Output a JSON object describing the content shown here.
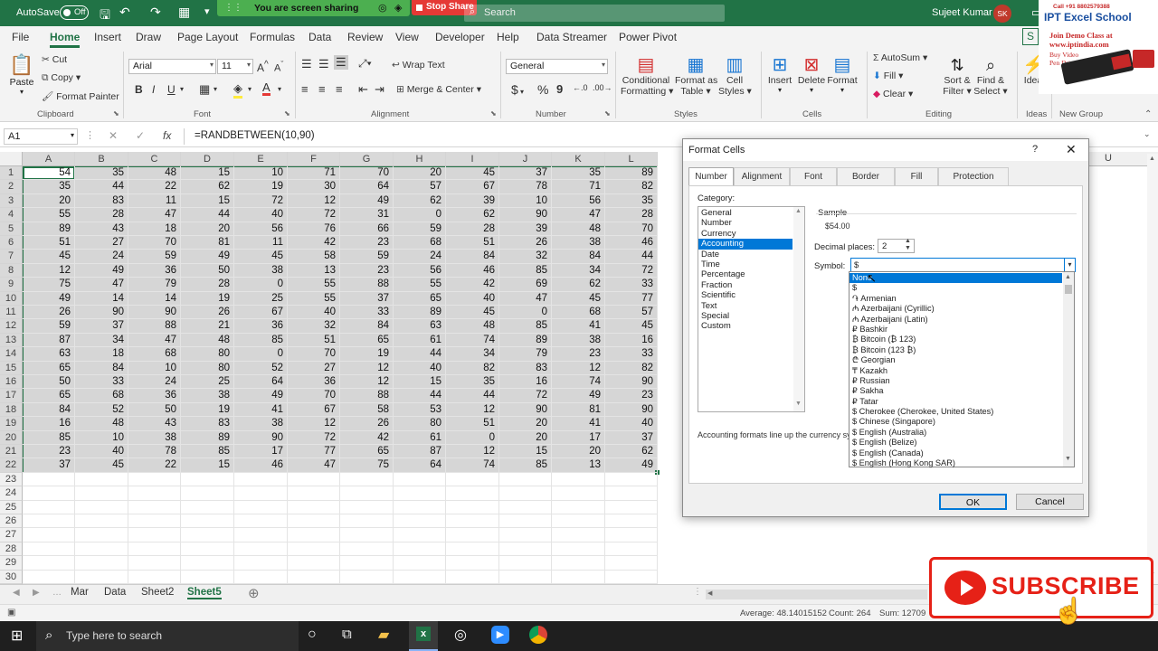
{
  "titlebar": {
    "autosave_label": "AutoSave",
    "autosave_state": "Off",
    "sharing_banner": "You are screen sharing",
    "stop_sharing": "Stop Share",
    "search_placeholder": "Search",
    "user_name": "Sujeet Kumar",
    "user_initials": "SK"
  },
  "tabs": [
    "File",
    "Home",
    "Insert",
    "Draw",
    "Page Layout",
    "Formulas",
    "Data",
    "Review",
    "View",
    "Developer",
    "Help",
    "Data Streamer",
    "Power Pivot"
  ],
  "share_label": "S",
  "ribbon": {
    "clipboard": {
      "paste": "Paste",
      "cut": "Cut",
      "copy": "Copy",
      "format_painter": "Format Painter",
      "label": "Clipboard"
    },
    "font": {
      "name": "Arial",
      "size": "11",
      "label": "Font",
      "bold": "B",
      "italic": "I",
      "underline": "U"
    },
    "alignment": {
      "wrap": "Wrap Text",
      "merge": "Merge & Center",
      "label": "Alignment"
    },
    "number": {
      "format": "General",
      "label": "Number",
      "currency_symbol": "$",
      "percent": "%",
      "comma": "9"
    },
    "styles": {
      "conditional": "Conditional",
      "conditional2": "Formatting",
      "format_as": "Format as",
      "format_as2": "Table",
      "cell": "Cell",
      "cell2": "Styles",
      "label": "Styles"
    },
    "cells": {
      "insert": "Insert",
      "delete": "Delete",
      "format": "Format",
      "label": "Cells"
    },
    "editing": {
      "autosum": "AutoSum",
      "fill": "Fill",
      "clear": "Clear",
      "sort": "Sort &",
      "sort2": "Filter",
      "find": "Find &",
      "find2": "Select",
      "label": "Editing"
    },
    "ideas": {
      "btn": "Idea",
      "label": "Ideas"
    },
    "newgroup": {
      "label": "New Group"
    }
  },
  "formula_bar": {
    "name_box": "A1",
    "fx": "fx",
    "formula": "=RANDBETWEEN(10,90)"
  },
  "columns": [
    "A",
    "B",
    "C",
    "D",
    "E",
    "F",
    "G",
    "H",
    "I",
    "J",
    "K",
    "L"
  ],
  "extra_column": "U",
  "rows": [
    [
      54,
      35,
      48,
      15,
      10,
      71,
      70,
      20,
      45,
      37,
      35,
      89
    ],
    [
      35,
      44,
      22,
      62,
      19,
      30,
      64,
      57,
      67,
      78,
      71,
      82
    ],
    [
      20,
      83,
      11,
      15,
      72,
      12,
      49,
      62,
      39,
      10,
      56,
      35
    ],
    [
      55,
      28,
      47,
      44,
      40,
      72,
      31,
      0,
      62,
      90,
      47,
      28
    ],
    [
      89,
      43,
      18,
      20,
      56,
      76,
      66,
      59,
      28,
      39,
      48,
      70
    ],
    [
      51,
      27,
      70,
      81,
      11,
      42,
      23,
      68,
      51,
      26,
      38,
      46
    ],
    [
      45,
      24,
      59,
      49,
      45,
      58,
      59,
      24,
      84,
      32,
      84,
      44
    ],
    [
      12,
      49,
      36,
      50,
      38,
      13,
      23,
      56,
      46,
      85,
      34,
      72
    ],
    [
      75,
      47,
      79,
      28,
      0,
      55,
      88,
      55,
      42,
      69,
      62,
      33
    ],
    [
      49,
      14,
      14,
      19,
      25,
      55,
      37,
      65,
      40,
      47,
      45,
      77
    ],
    [
      26,
      90,
      90,
      26,
      67,
      40,
      33,
      89,
      45,
      0,
      68,
      57
    ],
    [
      59,
      37,
      88,
      21,
      36,
      32,
      84,
      63,
      48,
      85,
      41,
      45
    ],
    [
      87,
      34,
      47,
      48,
      85,
      51,
      65,
      61,
      74,
      89,
      38,
      16
    ],
    [
      63,
      18,
      68,
      80,
      0,
      70,
      19,
      44,
      34,
      79,
      23,
      33
    ],
    [
      65,
      84,
      10,
      80,
      52,
      27,
      12,
      40,
      82,
      83,
      12,
      82
    ],
    [
      50,
      33,
      24,
      25,
      64,
      36,
      12,
      15,
      35,
      16,
      74,
      90
    ],
    [
      65,
      68,
      36,
      38,
      49,
      70,
      88,
      44,
      44,
      72,
      49,
      23
    ],
    [
      84,
      52,
      50,
      19,
      41,
      67,
      58,
      53,
      12,
      90,
      81,
      90
    ],
    [
      16,
      48,
      43,
      83,
      38,
      12,
      26,
      80,
      51,
      20,
      41,
      40
    ],
    [
      85,
      10,
      38,
      89,
      90,
      72,
      42,
      61,
      0,
      20,
      17,
      37
    ],
    [
      23,
      40,
      78,
      85,
      17,
      77,
      65,
      87,
      12,
      15,
      20,
      62
    ],
    [
      37,
      45,
      22,
      15,
      46,
      47,
      75,
      64,
      74,
      85,
      13,
      49
    ]
  ],
  "empty_rows": [
    "23",
    "24",
    "25",
    "26",
    "27",
    "28",
    "29",
    "30"
  ],
  "sheets": [
    "Mar",
    "Data",
    "Sheet2",
    "Sheet5"
  ],
  "active_sheet": "Sheet5",
  "status": {
    "average": "Average: 48.14015152",
    "count": "Count: 264",
    "sum": "Sum: 12709"
  },
  "taskbar": {
    "search_placeholder": "Type here to search"
  },
  "dialog": {
    "title": "Format Cells",
    "help": "?",
    "tabs": [
      "Number",
      "Alignment",
      "Font",
      "Border",
      "Fill",
      "Protection"
    ],
    "category_label": "Category:",
    "categories": [
      "General",
      "Number",
      "Currency",
      "Accounting",
      "Date",
      "Time",
      "Percentage",
      "Fraction",
      "Scientific",
      "Text",
      "Special",
      "Custom"
    ],
    "selected_category": "Accounting",
    "sample_label": "Sample",
    "sample_value": "$54.00",
    "decimal_label": "Decimal places:",
    "decimal_value": "2",
    "symbol_label": "Symbol:",
    "symbol_value": "$",
    "symbol_options": [
      "None",
      "$",
      "֏ Armenian",
      "₼ Azerbaijani (Cyrillic)",
      "₼ Azerbaijani (Latin)",
      "₽ Bashkir",
      "₿ Bitcoin (₿ 123)",
      "₿ Bitcoin (123 ₿)",
      "₾ Georgian",
      "₸ Kazakh",
      "₽ Russian",
      "₽ Sakha",
      "₽ Tatar",
      "$ Cherokee (Cherokee, United States)",
      "$ Chinese (Singapore)",
      "$ English (Australia)",
      "$ English (Belize)",
      "$ English (Canada)",
      "$ English (Hong Kong SAR)"
    ],
    "description": "Accounting formats line up the currency sym",
    "ok": "OK",
    "cancel": "Cancel"
  },
  "ad": {
    "call": "Call +91 8802579388",
    "brand": "IPT Excel School",
    "join": "Join Demo Class at",
    "site": "www.iptindia.com",
    "buy": "Buy Video",
    "pen": "Pen Drive"
  },
  "subscribe_label": "SUBSCRIBE"
}
